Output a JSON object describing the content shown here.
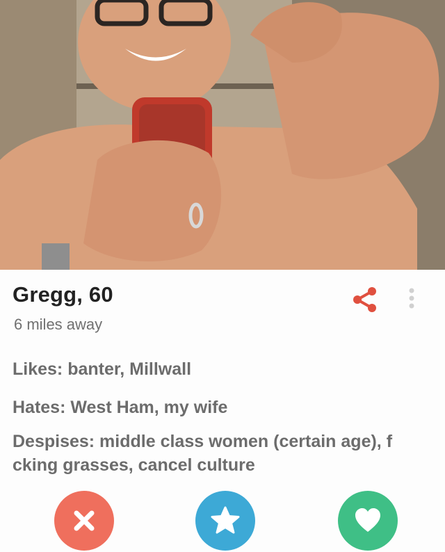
{
  "profile": {
    "name_age": "Gregg, 60",
    "distance": "6 miles away",
    "bio": {
      "likes": "Likes: banter, Millwall",
      "hates": "Hates: West Ham, my wife",
      "despises": "Despises: middle class women (certain age), f  cking grasses, cancel culture"
    }
  },
  "icons": {
    "share": "share-icon",
    "more": "more-vertical-icon",
    "nope": "close-icon",
    "super_like": "star-icon",
    "like": "heart-icon"
  },
  "colors": {
    "share_accent": "#e0503f",
    "nope": "#ef6f5d",
    "super_like": "#3da9d6",
    "like": "#3fbf86"
  }
}
